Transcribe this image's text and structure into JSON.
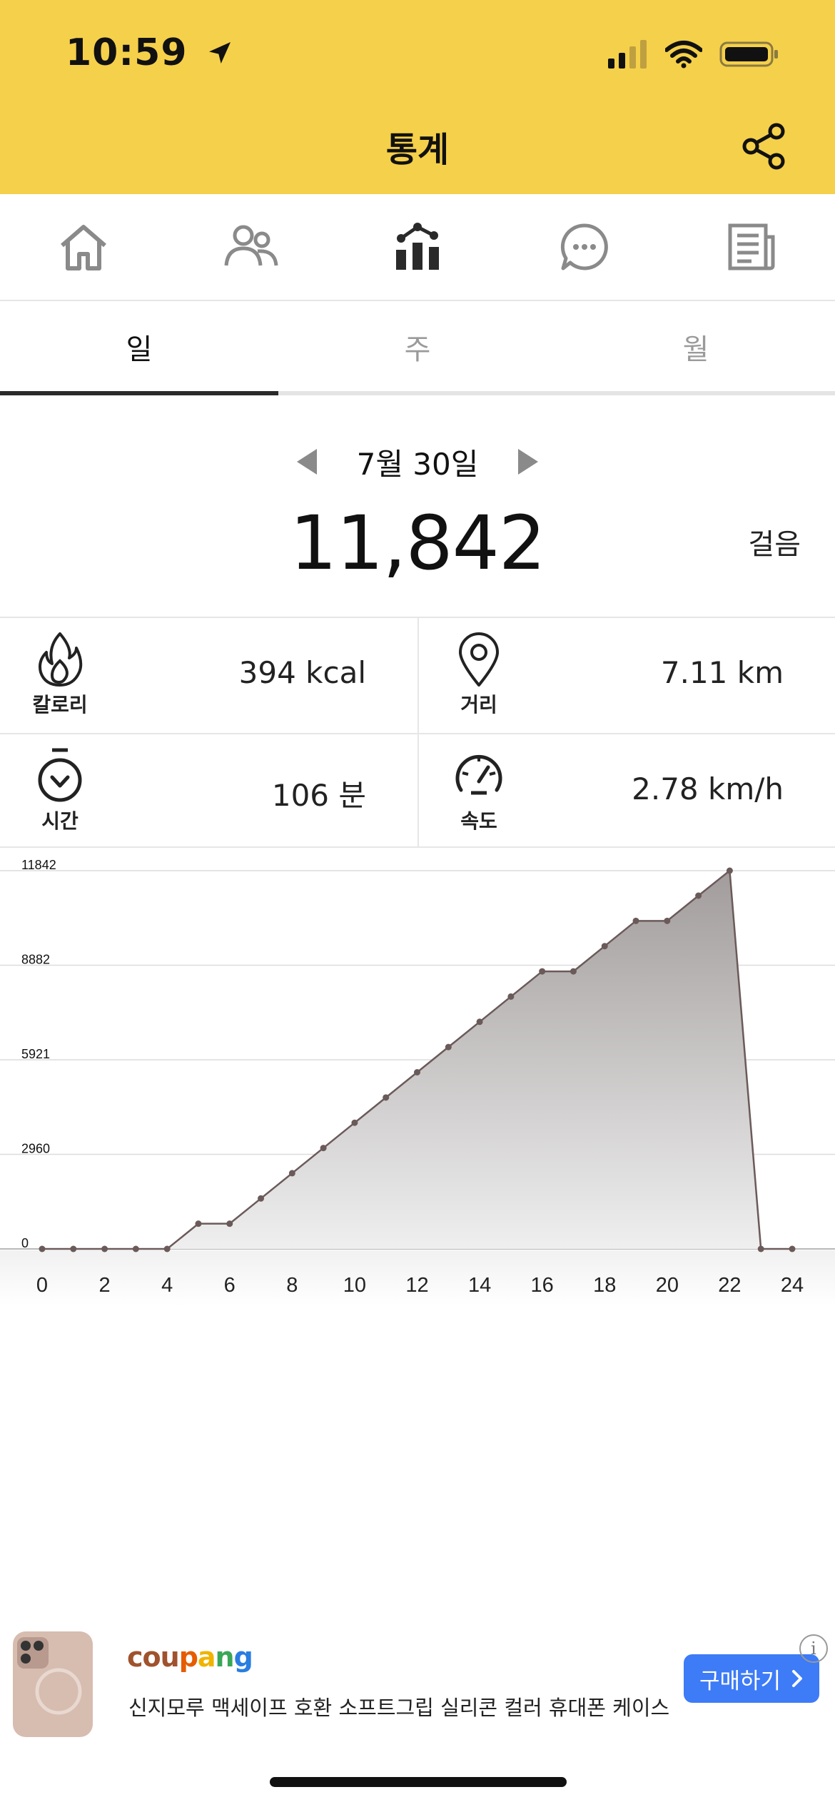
{
  "status_bar": {
    "time": "10:59"
  },
  "header": {
    "title": "통계"
  },
  "nav": [
    "home-icon",
    "friends-icon",
    "stats-icon",
    "chat-icon",
    "news-icon"
  ],
  "tabs": [
    "일",
    "주",
    "월"
  ],
  "active_tab": 0,
  "summary": {
    "date": "7월 30일",
    "steps": "11,842",
    "unit": "걸음"
  },
  "stats": {
    "calories": {
      "label": "칼로리",
      "value": "394 kcal"
    },
    "distance": {
      "label": "거리",
      "value": "7.11 km"
    },
    "time": {
      "label": "시간",
      "value": "106 분"
    },
    "speed": {
      "label": "속도",
      "value": "2.78 km/h"
    }
  },
  "chart_data": {
    "type": "area",
    "x": [
      0,
      1,
      2,
      3,
      4,
      5,
      6,
      7,
      8,
      9,
      10,
      11,
      12,
      13,
      14,
      15,
      16,
      17,
      18,
      19,
      20,
      21,
      22,
      23,
      24
    ],
    "y": [
      0,
      0,
      0,
      0,
      0,
      790,
      790,
      1580,
      2370,
      3160,
      3950,
      4740,
      5530,
      6320,
      7110,
      7900,
      8690,
      8690,
      9480,
      10270,
      10270,
      11060,
      11842,
      0,
      0
    ],
    "y_ticks": [
      "0",
      "2960",
      "5921",
      "8882",
      "11842"
    ],
    "x_ticks": [
      "0",
      "2",
      "4",
      "6",
      "8",
      "10",
      "12",
      "14",
      "16",
      "18",
      "20",
      "22",
      "24"
    ],
    "ylim": [
      0,
      11842
    ],
    "xlim": [
      0,
      24
    ],
    "grid": true
  },
  "ad": {
    "brand": [
      "cou",
      "p",
      "a",
      "n",
      "g"
    ],
    "text": "신지모루 맥세이프 호환 소프트그립 실리콘 컬러 휴대폰 케이스",
    "button": "구매하기",
    "info": "i"
  },
  "colors": {
    "header": "#F5D04A",
    "accent": "#3D7BF7",
    "chart_line": "#6b5a5a"
  }
}
